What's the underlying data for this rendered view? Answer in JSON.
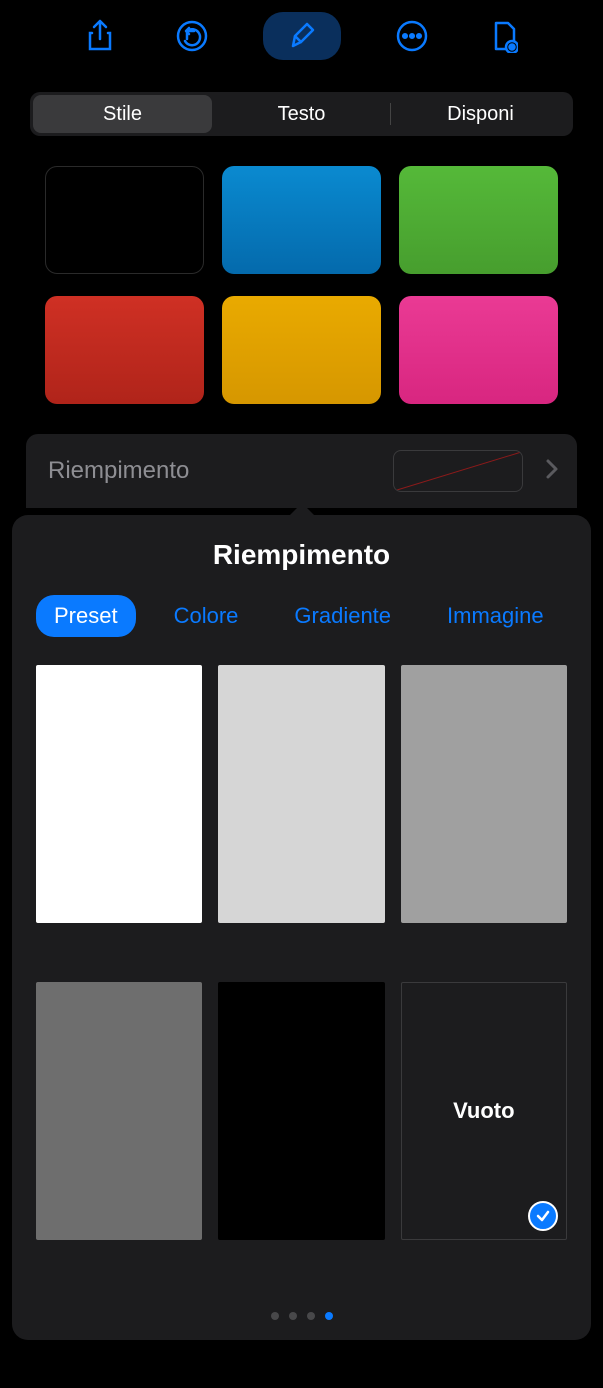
{
  "toolbar": {
    "icons": [
      "share",
      "undo",
      "brush",
      "more",
      "document"
    ]
  },
  "segments": {
    "style": "Stile",
    "text": "Testo",
    "arrange": "Disponi"
  },
  "colors": {
    "row1": [
      "#000000",
      "#057cc0",
      "#4eae33"
    ],
    "row2": [
      "#c22a1f",
      "#e2a200",
      "#e4308b"
    ]
  },
  "fill_section": {
    "label": "Riempimento"
  },
  "popup": {
    "title": "Riempimento",
    "tabs": {
      "preset": "Preset",
      "color": "Colore",
      "gradient": "Gradiente",
      "image": "Immagine"
    },
    "presets": {
      "colors": [
        "#ffffff",
        "#d6d6d6",
        "#a0a0a0",
        "#6e6e6e",
        "#000000"
      ],
      "empty_label": "Vuoto"
    },
    "page_count": 4,
    "active_page": 3
  }
}
